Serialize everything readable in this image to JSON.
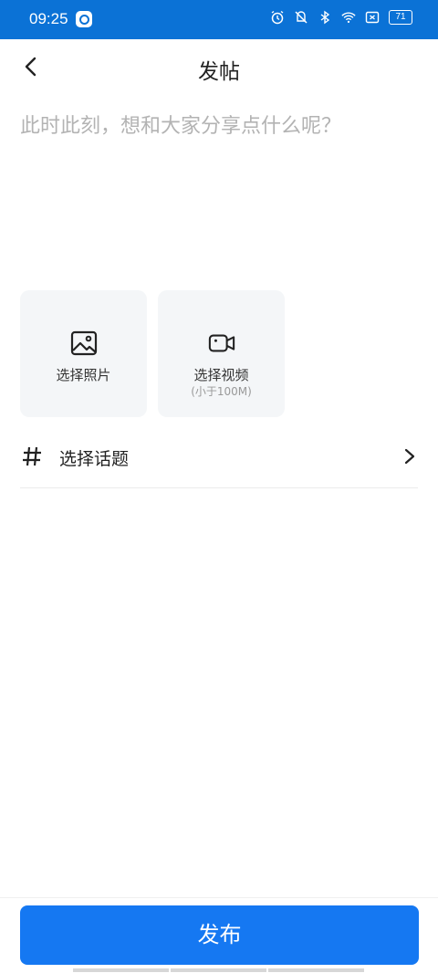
{
  "status_bar": {
    "time": "09:25",
    "battery": "71",
    "icons": [
      "app-icon",
      "alarm-icon",
      "mute-icon",
      "bluetooth-icon",
      "wifi-icon",
      "sim-icon",
      "battery-icon"
    ]
  },
  "header": {
    "title": "发帖",
    "back_icon": "chevron-left-icon"
  },
  "composer": {
    "placeholder": "此时此刻，想和大家分享点什么呢？",
    "value": ""
  },
  "media": {
    "photo_label": "选择照片",
    "photo_icon": "image-icon",
    "video_label": "选择视频",
    "video_sub": "(小于100M)",
    "video_icon": "video-camera-icon"
  },
  "topic": {
    "label": "选择话题",
    "icon": "hash-icon",
    "chevron": "chevron-right-icon"
  },
  "footer": {
    "publish_label": "发布"
  },
  "colors": {
    "status_bar": "#0b72d6",
    "primary": "#1578f2",
    "tile_bg": "#f4f6f8",
    "placeholder": "#b3b3b3"
  }
}
